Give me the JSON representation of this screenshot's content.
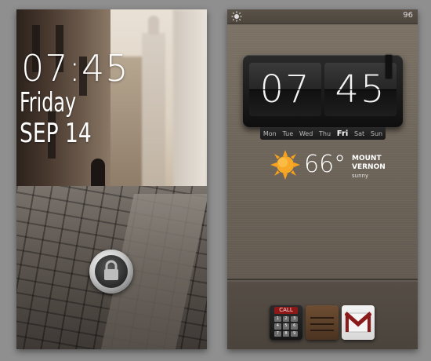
{
  "lock_screen": {
    "time": "07:45",
    "day": "Friday",
    "date": "SEP 14",
    "unlock_icon": "lock-icon"
  },
  "home_screen": {
    "status_bar": {
      "left_icon": "brightness-icon",
      "battery": "96"
    },
    "clock": {
      "hours": "07",
      "minutes": "45",
      "days": [
        "Mon",
        "Tue",
        "Wed",
        "Thu",
        "Fri",
        "Sat",
        "Sun"
      ],
      "active_day": "Fri"
    },
    "weather": {
      "icon": "sun-icon",
      "temperature": "66°",
      "city_line1": "MOUNT",
      "city_line2": "VERNON",
      "condition": "sunny"
    },
    "dock": {
      "apps": [
        {
          "name": "phone",
          "label": "CALL",
          "icon": "phone-keypad-icon"
        },
        {
          "name": "app-drawer",
          "icon": "drawer-icon"
        },
        {
          "name": "gmail",
          "icon": "mail-icon"
        }
      ]
    }
  }
}
